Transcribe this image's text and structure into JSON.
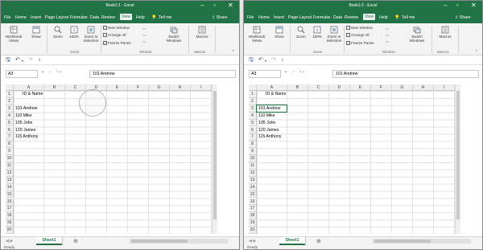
{
  "windows": [
    {
      "title": "Book1:1 - Excel",
      "menu": [
        "File",
        "Home",
        "Insert",
        "Page Layout",
        "Formulas",
        "Data",
        "Review",
        "View",
        "Help"
      ],
      "active_tab": "View",
      "tell_me": "Tell me",
      "share": "Share",
      "ribbon": {
        "workbook_views": "Workbook Views",
        "show": "Show",
        "zoom": "Zoom",
        "zoom_100": "100%",
        "zoom_to_selection": "Zoom to Selection",
        "new_window": "New Window",
        "arrange_all": "Arrange All",
        "freeze_panes": "Freeze Panes",
        "switch_windows": "Switch Windows",
        "macros": "Macros",
        "group_zoom": "Zoom",
        "group_window": "Window",
        "group_macros": "Macros"
      },
      "name_box": "A3",
      "formula": "101 Andrew",
      "columns": [
        "A",
        "B",
        "C",
        "D",
        "E",
        "F",
        "G",
        "H",
        "I"
      ],
      "rows": [
        "1",
        "2",
        "3",
        "4",
        "5",
        "6",
        "7",
        "8",
        "9",
        "10",
        "11",
        "12",
        "13",
        "14",
        "15",
        "16",
        "17",
        "18",
        "19",
        "20"
      ],
      "cells": {
        "A1": "ID & Name",
        "A3": "101 Andrew",
        "A4": "110 Mike",
        "A5": "105 John",
        "A6": "120 James",
        "A7": "115 Anthony"
      },
      "sheet": "Sheet1",
      "status": "Ready"
    },
    {
      "title": "Book1:2 - Excel",
      "menu": [
        "File",
        "Home",
        "Insert",
        "Page Layout",
        "Formulas",
        "Data",
        "Review",
        "View",
        "Help"
      ],
      "active_tab": "View",
      "tell_me": "Tell me",
      "share": "Share",
      "ribbon": {
        "workbook_views": "Workbook Views",
        "show": "Show",
        "zoom": "Zoom",
        "zoom_100": "100%",
        "zoom_to_selection": "Zoom to Selection",
        "new_window": "New Window",
        "arrange_all": "Arrange All",
        "freeze_panes": "Freeze Panes",
        "switch_windows": "Switch Windows",
        "macros": "Macros",
        "group_zoom": "Zoom",
        "group_window": "Window",
        "group_macros": "Macros"
      },
      "name_box": "A3",
      "formula": "101 Andrew",
      "columns": [
        "A",
        "B",
        "C",
        "D",
        "E",
        "F",
        "G",
        "H",
        "I"
      ],
      "rows": [
        "1",
        "2",
        "3",
        "4",
        "5",
        "6",
        "7",
        "8",
        "9",
        "10",
        "11",
        "12",
        "13",
        "14",
        "15",
        "16",
        "17",
        "18",
        "19",
        "20"
      ],
      "cells": {
        "A1": "ID & Name",
        "A3": "101 Andrew",
        "A4": "110 Mike",
        "A5": "105 John",
        "A6": "120 James",
        "A7": "115 Anthony"
      },
      "sheet": "Sheet1",
      "status": "Ready"
    }
  ],
  "colors": {
    "excel_green": "#217346",
    "ribbon_bg": "#f3f3f3",
    "header_bg": "#efefef"
  }
}
